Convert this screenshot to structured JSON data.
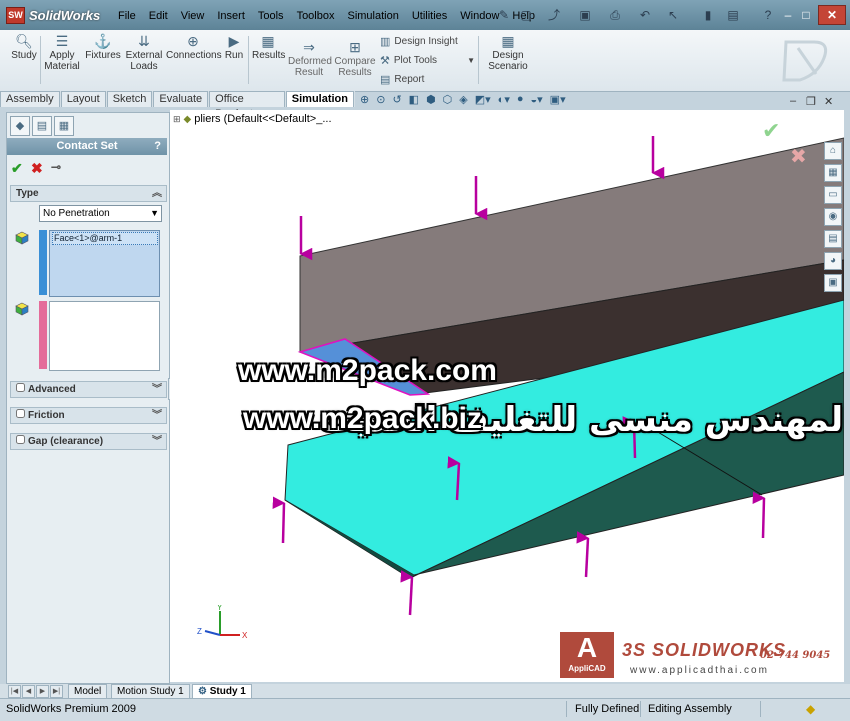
{
  "app": {
    "brand": "SolidWorks",
    "logo_mark": "SW",
    "menu": [
      "File",
      "Edit",
      "View",
      "Insert",
      "Tools",
      "Toolbox",
      "Simulation",
      "Utilities",
      "Window",
      "Help"
    ]
  },
  "command_manager": {
    "study": "Study",
    "apply_material_1": "Apply",
    "apply_material_2": "Material",
    "fixtures": "Fixtures",
    "external_loads_1": "External",
    "external_loads_2": "Loads",
    "connections": "Connections",
    "run": "Run",
    "results": "Results",
    "deformed_result_1": "Deformed",
    "deformed_result_2": "Result",
    "compare_results_1": "Compare",
    "compare_results_2": "Results",
    "design_insight": "Design Insight",
    "plot_tools": "Plot Tools",
    "report": "Report",
    "design_scenario_1": "Design",
    "design_scenario_2": "Scenario"
  },
  "tabs": [
    "Assembly",
    "Layout",
    "Sketch",
    "Evaluate",
    "Office Products",
    "Simulation"
  ],
  "active_tab": "Simulation",
  "property_manager": {
    "title": "Contact Set",
    "help": "?",
    "type_group": "Type",
    "type_value": "No Penetration",
    "face_selection": "Face<1>@arm-1",
    "advanced": "Advanced",
    "friction": "Friction",
    "gap": "Gap (clearance)"
  },
  "viewport": {
    "tree_path": "pliers  (Default<<Default>_...",
    "watermark_arabic": "شركة المهندس منسى للتغليف الحديث",
    "watermark_url1": "www.m2pack.com",
    "watermark_url2": "www.m2pack.biz",
    "brand_logo_text": "AppliCAD",
    "brand_name": "SOLIDWORKS",
    "brand_prefix": "3S",
    "phone": "02-744 9045",
    "website": "www.applicadthai.com",
    "triad_x": "X",
    "triad_y": "Y",
    "triad_z": "Z"
  },
  "bottom_tabs": {
    "model": "Model",
    "motion_study": "Motion Study 1",
    "study": "Study 1"
  },
  "status_bar": {
    "product": "SolidWorks Premium 2009",
    "state": "Fully Defined",
    "mode": "Editing Assembly"
  },
  "colors": {
    "top_face": "#857b7b",
    "dark_face": "#3b302f",
    "cyan_face": "#33ece0",
    "teal_face": "#1e5a4e",
    "contact_face": "#5590d8",
    "force_arrow": "#b8009f"
  }
}
